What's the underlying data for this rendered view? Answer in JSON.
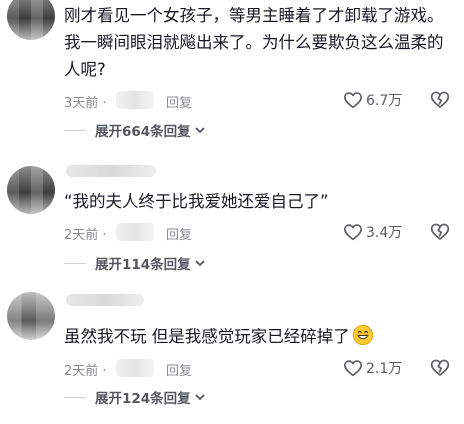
{
  "comments": [
    {
      "text": "刚才看见一个女孩子，等男主睡着了才卸载了游戏。我一瞬间眼泪就飚出来了。为什么要欺负这么温柔的人呢?",
      "time": "3天前 ·",
      "reply_label": "回复",
      "likes": "6.7万",
      "expand_label": "展开664条回复"
    },
    {
      "text": "“我的夫人终于比我爱她还爱自己了”",
      "time": "2天前 ·",
      "reply_label": "回复",
      "likes": "3.4万",
      "expand_label": "展开114条回复"
    },
    {
      "text": "虽然我不玩 但是我感觉玩家已经碎掉了",
      "time": "2天前 ·",
      "reply_label": "回复",
      "likes": "2.1万",
      "expand_label": "展开124条回复"
    }
  ],
  "icons": {
    "like": "heart-outline-icon",
    "dislike": "broken-heart-icon",
    "expand": "chevron-down-icon",
    "emoji": "grinning-sweat-emoji"
  },
  "colors": {
    "text": "#161823",
    "meta": "#8a8b91",
    "expand": "#555761",
    "background": "#ffffff"
  }
}
